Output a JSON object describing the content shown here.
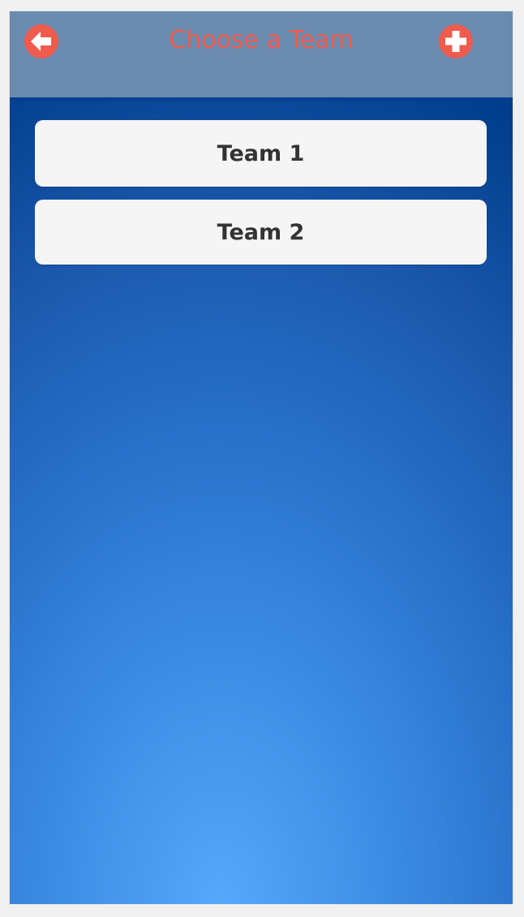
{
  "header": {
    "title": "Choose a Team",
    "back_icon": "arrow-left-circle",
    "add_icon": "plus-circle",
    "accent_color": "#ef5b4c",
    "bar_color": "#6a8aaf"
  },
  "teams": [
    {
      "label": "Team 1"
    },
    {
      "label": "Team 2"
    }
  ]
}
